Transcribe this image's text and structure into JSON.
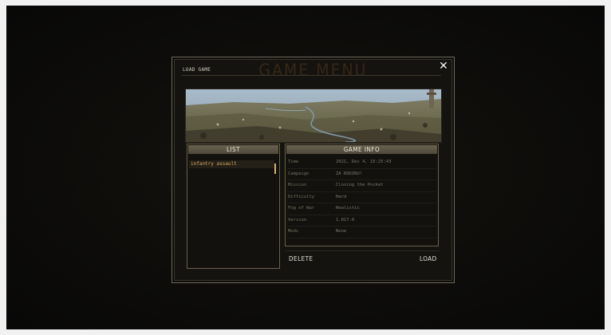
{
  "dialog": {
    "window_title": "LOAD GAME",
    "background_title": "GAME MENU",
    "close_symbol": "✕"
  },
  "list": {
    "header": "LIST",
    "items": [
      "infantry assault"
    ]
  },
  "info": {
    "header": "GAME INFO",
    "rows": [
      {
        "label": "Time",
        "value": "2021, Dec 4, 15:25:43"
      },
      {
        "label": "Campaign",
        "value": "ZA RODINU!"
      },
      {
        "label": "Mission",
        "value": "Closing the Pocket"
      },
      {
        "label": "Difficulty",
        "value": "Hard"
      },
      {
        "label": "Fog of War",
        "value": "Realistic"
      },
      {
        "label": "Version",
        "value": "1.017.0"
      },
      {
        "label": "Mods",
        "value": "None"
      }
    ]
  },
  "actions": {
    "delete_label": "DELETE",
    "load_label": "LOAD"
  },
  "colors": {
    "accent": "#d9a85f",
    "header_bg": "#5d5645",
    "panel_border": "#6a604b"
  }
}
